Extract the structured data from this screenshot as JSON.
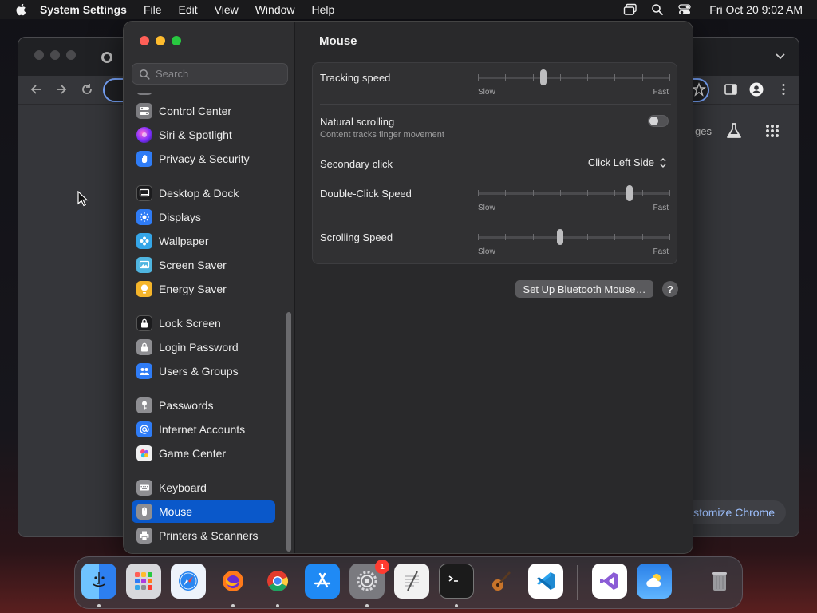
{
  "menubar": {
    "app_name": "System Settings",
    "menus": [
      "File",
      "Edit",
      "View",
      "Window",
      "Help"
    ],
    "clock": "Fri Oct 20  9:02 AM",
    "icons": [
      "apple-icon",
      "screen-mirroring-icon",
      "spotlight-search-icon",
      "control-center-icon"
    ]
  },
  "chrome": {
    "ntp_link": "ges",
    "customize_label": "ustomize Chrome"
  },
  "settings": {
    "search": {
      "placeholder": "Search",
      "value": ""
    },
    "sidebar": {
      "items": [
        {
          "label": "Control Center",
          "icon": "control-center-icon",
          "color": "#7c7c80"
        },
        {
          "label": "Siri & Spotlight",
          "icon": "siri-icon",
          "color": "#b03be0"
        },
        {
          "label": "Privacy & Security",
          "icon": "hand-icon",
          "color": "#2f7cf6"
        },
        {
          "label": "Desktop & Dock",
          "icon": "dock-icon",
          "color": "#1c1c1e"
        },
        {
          "label": "Displays",
          "icon": "sun-icon",
          "color": "#2f7cf6"
        },
        {
          "label": "Wallpaper",
          "icon": "flower-icon",
          "color": "#35a6e8"
        },
        {
          "label": "Screen Saver",
          "icon": "screen-saver-icon",
          "color": "#4fb5e0"
        },
        {
          "label": "Energy Saver",
          "icon": "lightbulb-icon",
          "color": "#f5b52a"
        },
        {
          "label": "Lock Screen",
          "icon": "lock-icon",
          "color": "#1c1c1e"
        },
        {
          "label": "Login Password",
          "icon": "lock-icon",
          "color": "#8e8e92"
        },
        {
          "label": "Users & Groups",
          "icon": "users-icon",
          "color": "#2f7cf6"
        },
        {
          "label": "Passwords",
          "icon": "key-icon",
          "color": "#8e8e92"
        },
        {
          "label": "Internet Accounts",
          "icon": "at-icon",
          "color": "#2f7cf6"
        },
        {
          "label": "Game Center",
          "icon": "game-center-icon",
          "color": "#f0f0f0"
        },
        {
          "label": "Keyboard",
          "icon": "keyboard-icon",
          "color": "#8e8e92"
        },
        {
          "label": "Mouse",
          "icon": "mouse-icon",
          "color": "#8e8e92",
          "selected": true
        },
        {
          "label": "Printers & Scanners",
          "icon": "printer-icon",
          "color": "#8e8e92"
        }
      ]
    },
    "pane": {
      "title": "Mouse",
      "tracking": {
        "label": "Tracking speed",
        "min_label": "Slow",
        "max_label": "Fast",
        "value": 0.34
      },
      "natural_scrolling": {
        "label": "Natural scrolling",
        "sublabel": "Content tracks finger movement",
        "on": false
      },
      "secondary_click": {
        "label": "Secondary click",
        "value": "Click Left Side"
      },
      "double_click": {
        "label": "Double-Click Speed",
        "min_label": "Slow",
        "max_label": "Fast",
        "value": 0.79
      },
      "scrolling": {
        "label": "Scrolling Speed",
        "min_label": "Slow",
        "max_label": "Fast",
        "value": 0.43
      },
      "bluetooth_button": "Set Up Bluetooth Mouse…",
      "help_label": "?"
    }
  },
  "dock": {
    "apps": [
      {
        "name": "Finder",
        "icon": "finder-icon",
        "color": "#3a8ef0",
        "running": true
      },
      {
        "name": "Launchpad",
        "icon": "launchpad-icon",
        "color": "#d8d8dc",
        "running": false
      },
      {
        "name": "Safari",
        "icon": "safari-icon",
        "color": "#eef3fb",
        "running": false
      },
      {
        "name": "Firefox",
        "icon": "firefox-icon",
        "color": "#ff7a1a",
        "running": true
      },
      {
        "name": "Chrome",
        "icon": "chrome-icon",
        "color": "#ffffff",
        "running": true
      },
      {
        "name": "App Store",
        "icon": "app-store-icon",
        "color": "#1f8af5",
        "running": false
      },
      {
        "name": "System Settings",
        "icon": "gear-icon",
        "color": "#8e8e93",
        "running": true,
        "badge": "1"
      },
      {
        "name": "TextEdit",
        "icon": "textedit-icon",
        "color": "#f2f2f2",
        "running": false
      },
      {
        "name": "Terminal",
        "icon": "terminal-icon",
        "color": "#1b1b1b",
        "running": true
      },
      {
        "name": "GarageBand",
        "icon": "guitar-icon",
        "color": "#3a2a1a",
        "running": false
      },
      {
        "name": "Visual Studio Code",
        "icon": "vscode-icon",
        "color": "#ffffff",
        "running": false
      },
      {
        "name": "Visual Studio",
        "icon": "visual-studio-icon",
        "color": "#ffffff",
        "running": false
      },
      {
        "name": "Weather",
        "icon": "weather-icon",
        "color": "#2a80e8",
        "running": false
      },
      {
        "name": "Trash",
        "icon": "trash-icon",
        "color": "#9a9a9e",
        "running": false
      }
    ]
  }
}
